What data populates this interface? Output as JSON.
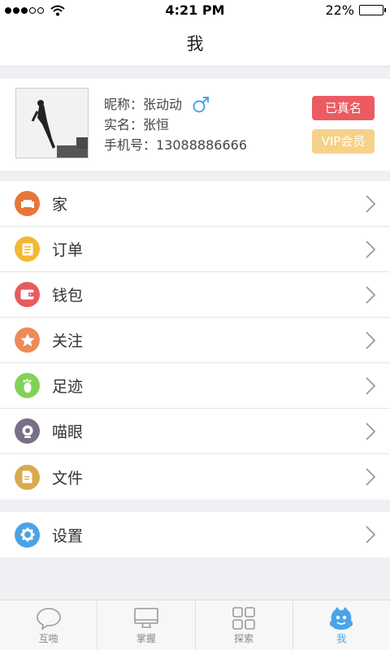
{
  "status": {
    "time": "4:21 PM",
    "battery": "22%",
    "battery_level": 0.22
  },
  "header": {
    "title": "我"
  },
  "profile": {
    "nickname_label": "昵称：",
    "nickname": "张动动",
    "gender": "male",
    "realname_label": "实名：",
    "realname": "张恒",
    "phone_label": "手机号：",
    "phone": "13088886666",
    "verified_badge": "已真名",
    "vip_badge": "VIP会员"
  },
  "menu": {
    "items": [
      {
        "label": "家",
        "icon": "sofa-icon",
        "color": "#e8763a"
      },
      {
        "label": "订单",
        "icon": "clipboard-icon",
        "color": "#f3b733"
      },
      {
        "label": "钱包",
        "icon": "wallet-icon",
        "color": "#e85b5e"
      },
      {
        "label": "关注",
        "icon": "star-icon",
        "color": "#ec8a5a"
      },
      {
        "label": "足迹",
        "icon": "footprint-icon",
        "color": "#82d257"
      },
      {
        "label": "喵眼",
        "icon": "camera-icon",
        "color": "#7a6f86"
      },
      {
        "label": "文件",
        "icon": "document-icon",
        "color": "#d9a94e"
      }
    ],
    "settings": {
      "label": "设置",
      "icon": "gear-icon",
      "color": "#4ba3e3"
    }
  },
  "tabbar": {
    "tabs": [
      {
        "label": "互啪",
        "icon": "chat-bubble-icon"
      },
      {
        "label": "掌握",
        "icon": "monitor-icon"
      },
      {
        "label": "探索",
        "icon": "grid-icon"
      },
      {
        "label": "我",
        "icon": "mascot-icon",
        "active": true
      }
    ]
  }
}
